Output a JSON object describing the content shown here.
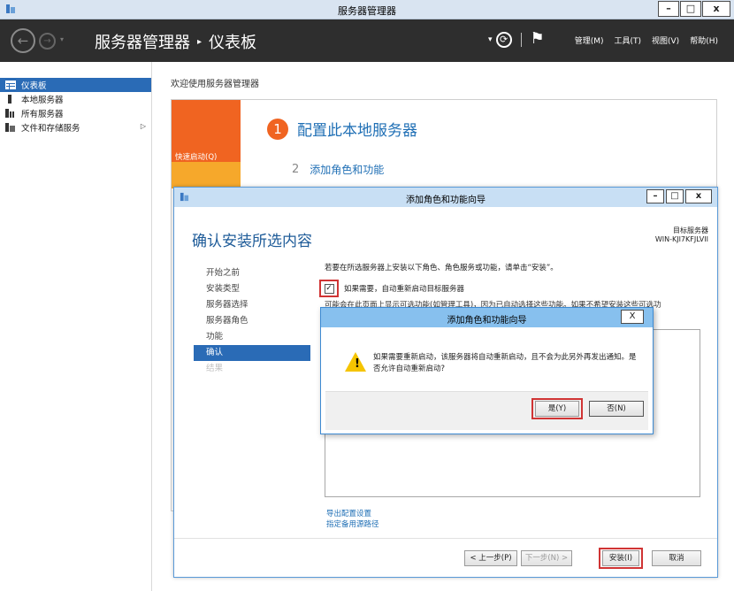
{
  "window": {
    "title": "服务器管理器",
    "minimize": "–",
    "maximize": "□",
    "close": "x"
  },
  "header": {
    "breadcrumb": [
      "服务器管理器",
      "仪表板"
    ],
    "menus": [
      "管理(M)",
      "工具(T)",
      "视图(V)",
      "帮助(H)"
    ]
  },
  "sidebar": {
    "items": [
      {
        "label": "仪表板"
      },
      {
        "label": "本地服务器"
      },
      {
        "label": "所有服务器"
      },
      {
        "label": "文件和存储服务"
      }
    ]
  },
  "main": {
    "welcome": "欢迎使用服务器管理器",
    "quickstart": "快速启动(Q)",
    "step1_num": "1",
    "step1": "配置此本地服务器",
    "step2_num": "2",
    "step2": "添加角色和功能"
  },
  "wizard": {
    "title": "添加角色和功能向导",
    "heading": "确认安装所选内容",
    "target_label": "目标服务器",
    "target_value": "WIN-KJI7KFJLVII",
    "nav": [
      "开始之前",
      "安装类型",
      "服务器选择",
      "服务器角色",
      "功能",
      "确认",
      "结果"
    ],
    "intro": "若要在所选服务器上安装以下角色、角色服务或功能，请单击“安装”。",
    "checkbox_label": "如果需要，自动重新启动目标服务器",
    "note": "可能会在此页面上显示可选功能(如管理工具)，因为已自动选择这些功能。如果不希望安装这些可选功",
    "link_export": "导出配置设置",
    "link_source": "指定备用源路径",
    "btn_prev": "< 上一步(P)",
    "btn_next": "下一步(N) >",
    "btn_install": "安装(I)",
    "btn_cancel": "取消"
  },
  "dialog": {
    "title": "添加角色和功能向导",
    "close": "X",
    "message": "如果需要重新启动，该服务器将自动重新启动，且不会为此另外再发出通知。是否允许自动重新启动?",
    "btn_yes": "是(Y)",
    "btn_no": "否(N)"
  },
  "colors": {
    "accent": "#2a6bb6",
    "orange": "#f06421",
    "highlight": "#d03434"
  }
}
